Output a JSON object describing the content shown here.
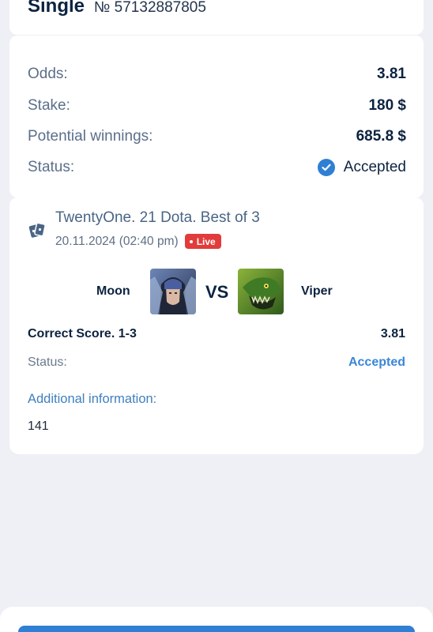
{
  "header": {
    "bet_type": "Single",
    "bet_number": "№ 57132887805"
  },
  "summary": {
    "odds_label": "Odds:",
    "odds_value": "3.81",
    "stake_label": "Stake:",
    "stake_value": "180 $",
    "winnings_label": "Potential winnings:",
    "winnings_value": "685.8 $",
    "status_label": "Status:",
    "status_value": "Accepted",
    "status_icon": "check-circle-icon"
  },
  "event": {
    "icon": "cards-icon",
    "title": "TwentyOne. 21 Dota. Best of 3",
    "datetime": "20.11.2024 (02:40 pm)",
    "live_badge": "Live",
    "team1": "Moon",
    "team2": "Viper",
    "vs": "VS",
    "bet_market": "Correct Score. 1-3",
    "bet_odds": "3.81",
    "status_label": "Status:",
    "status_value": "Accepted",
    "additional_label": "Additional information:",
    "additional_value": "141"
  },
  "colors": {
    "accent": "#2f7fd4",
    "live": "#e23b3b",
    "background": "#eef0f5"
  }
}
